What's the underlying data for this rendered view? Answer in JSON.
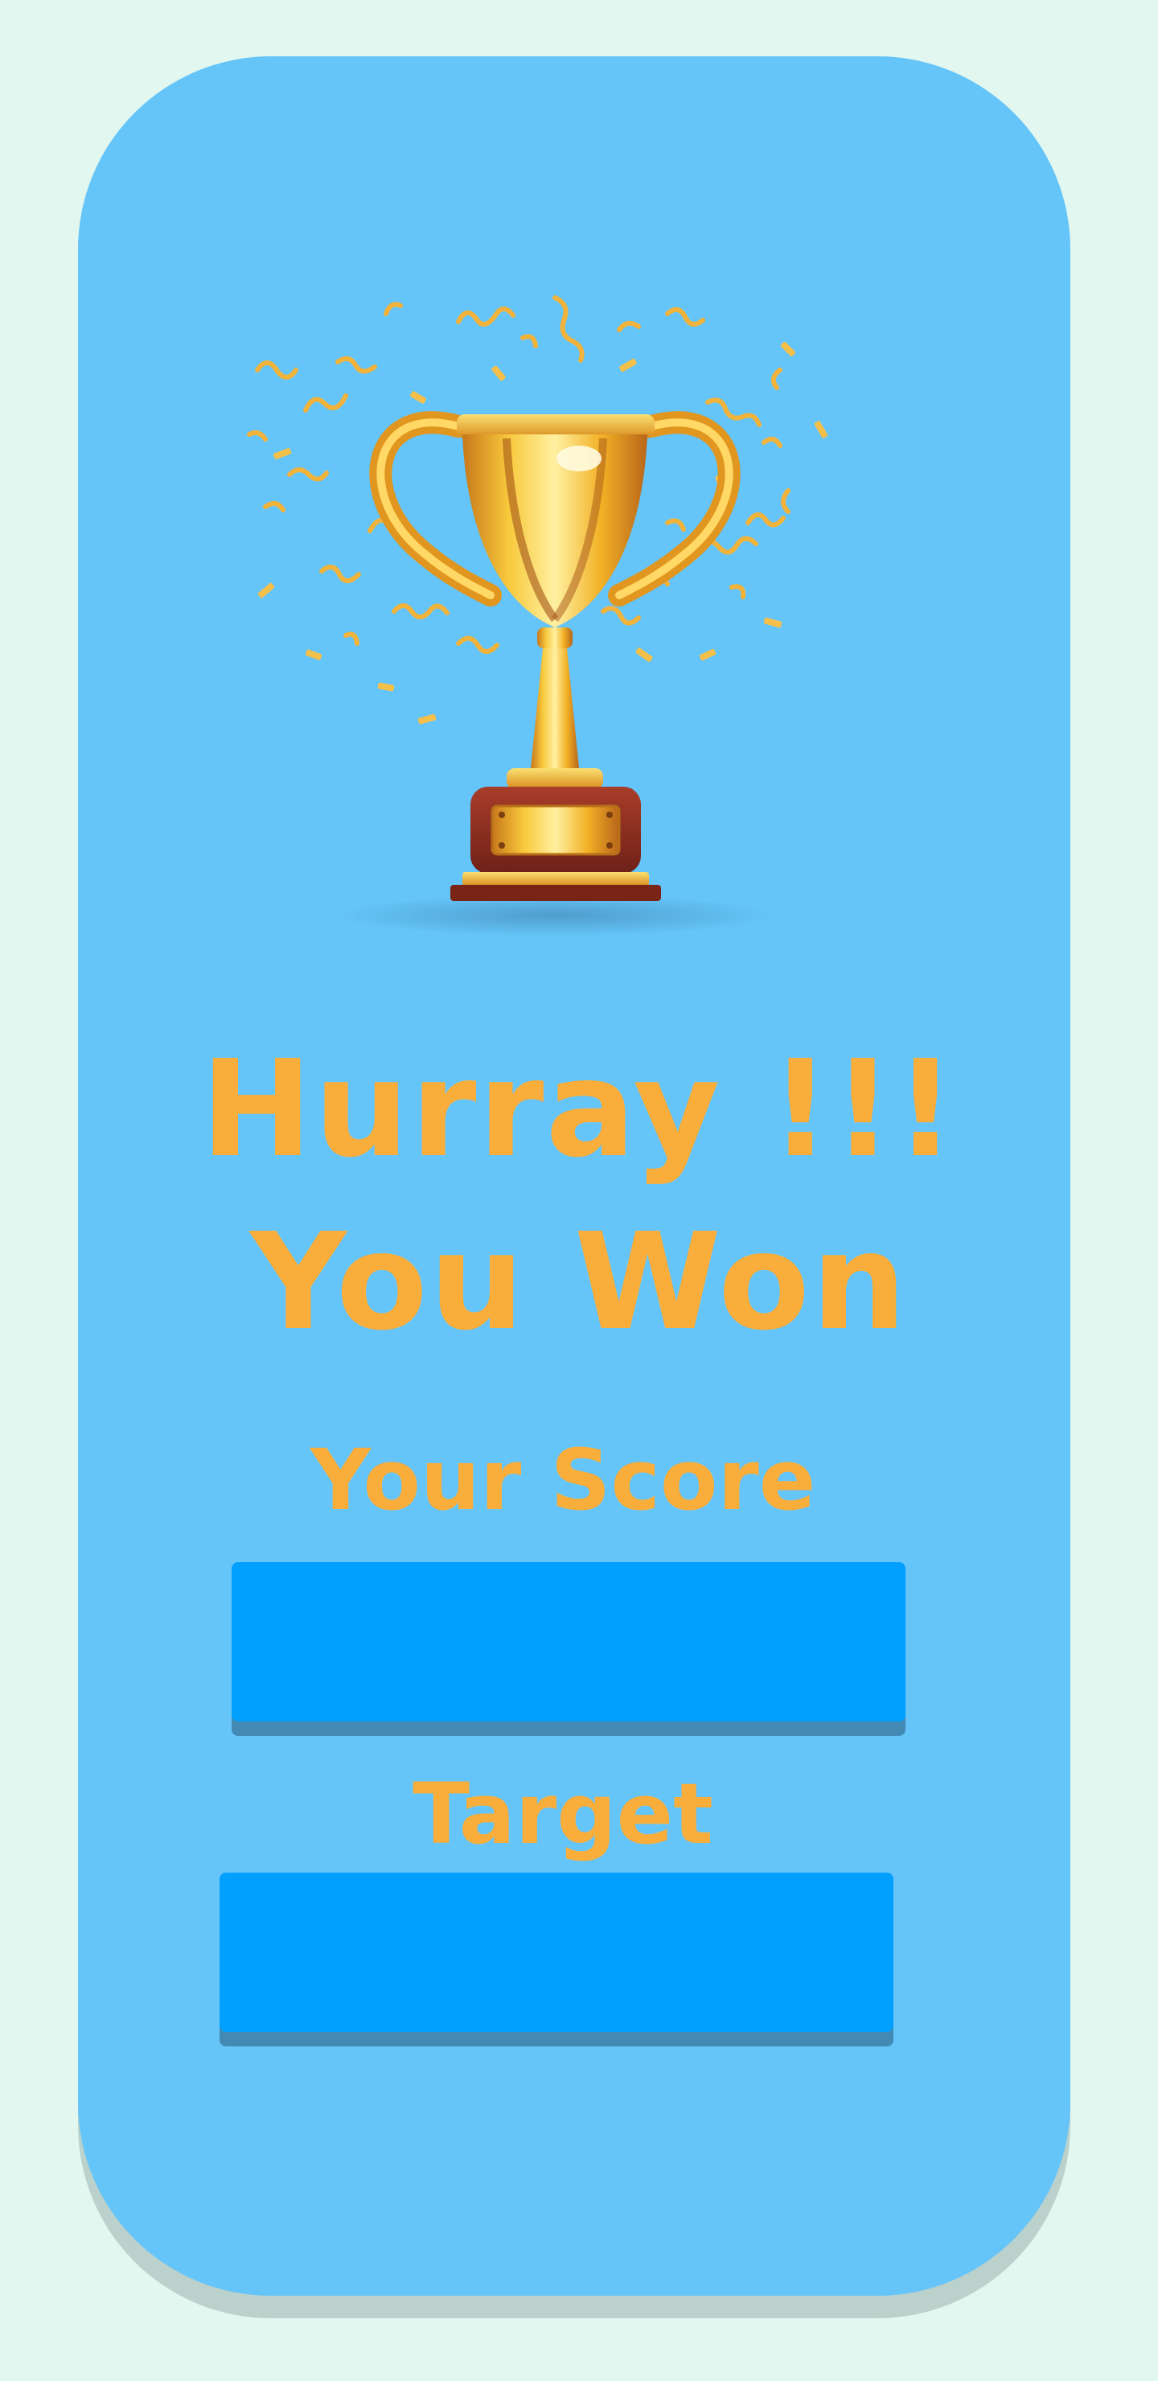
{
  "headline": {
    "line1": "Hurray !!!",
    "line2": "You Won"
  },
  "score": {
    "label": "Your Score",
    "value": ""
  },
  "target": {
    "label": "Target",
    "value": ""
  },
  "icons": {
    "trophy": "trophy-icon",
    "confetti": "confetti-icon"
  },
  "colors": {
    "page_background": "#e1f7f0",
    "card_background": "#65c4f8",
    "headline_text": "#f9ae3b",
    "value_box": "#019ffe",
    "value_box_shadow": "#4289b4",
    "trophy_gold": "#f5b82a",
    "trophy_base": "#8e2b1f"
  }
}
